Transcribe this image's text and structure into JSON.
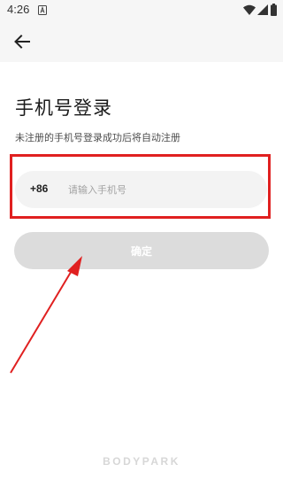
{
  "status_bar": {
    "time": "4:26",
    "icons": [
      "notification-a-icon",
      "wifi-icon",
      "signal-icon",
      "battery-icon"
    ]
  },
  "app_bar": {
    "back_icon": "arrow-left-icon"
  },
  "login": {
    "title": "手机号登录",
    "subtitle": "未注册的手机号登录成功后将自动注册",
    "country_code": "+86",
    "phone_value": "",
    "phone_placeholder": "请输入手机号",
    "confirm_label": "确定"
  },
  "brand": {
    "logo_text": "BODYPARK"
  },
  "colors": {
    "annotation_red": "#e02020",
    "button_disabled": "#dcdcdc",
    "input_bg": "#f3f3f3",
    "header_bg": "#f6f6f6"
  }
}
